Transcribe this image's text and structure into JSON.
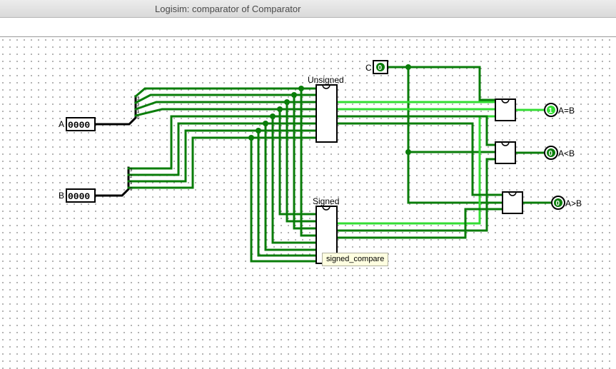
{
  "window": {
    "title": "Logisim: comparator of Comparator"
  },
  "circuit": {
    "inputs": [
      {
        "label": "A",
        "value": "0000"
      },
      {
        "label": "B",
        "value": "0000"
      },
      {
        "label": "C",
        "value": "0"
      }
    ],
    "components": [
      {
        "label": "Unsigned"
      },
      {
        "label": "Signed"
      }
    ],
    "outputs": [
      {
        "label": "A=B",
        "value": "1"
      },
      {
        "label": "A<B",
        "value": "0"
      },
      {
        "label": "A>B",
        "value": "0"
      }
    ],
    "splitter_bits": [
      "3",
      "2",
      "1",
      "0"
    ]
  },
  "tooltip": {
    "text": "signed_compare"
  },
  "colors": {
    "wire_dark": "#0a7d0a",
    "wire_bright": "#33dd33",
    "bus": "#000000"
  }
}
